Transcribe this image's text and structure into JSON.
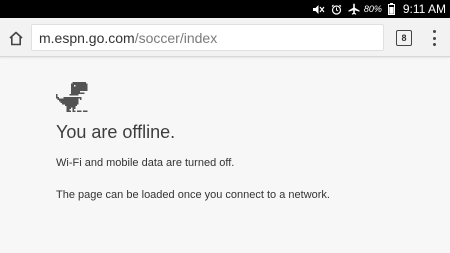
{
  "status_bar": {
    "icons": [
      "mute-icon",
      "alarm-icon",
      "airplane-mode-icon",
      "battery-icon"
    ],
    "battery_percent": "80%",
    "time": "9:11 AM"
  },
  "toolbar": {
    "url_host": "m.espn.go.com",
    "url_path": "/soccer/index",
    "tab_count": "8"
  },
  "page": {
    "title": "You are offline.",
    "message_1": "Wi-Fi and mobile data are turned off.",
    "message_2": "The page can be loaded once you connect to a network."
  },
  "colors": {
    "status_bar_bg": "#000000",
    "toolbar_bg": "#f2f2f2",
    "page_bg": "#f7f7f7",
    "dino": "#535353"
  }
}
